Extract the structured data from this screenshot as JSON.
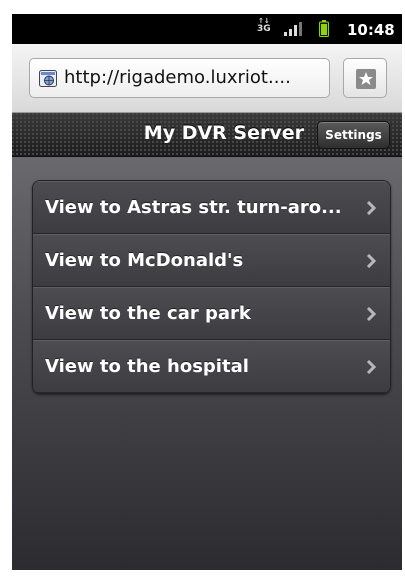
{
  "status_bar": {
    "network_label": "3G",
    "time": "10:48"
  },
  "browser": {
    "url": "http://rigademo.luxriot...."
  },
  "header": {
    "title": "My DVR Server",
    "settings_label": "Settings"
  },
  "cameras": [
    {
      "label": "View to Astras str. turn-aro..."
    },
    {
      "label": "View to McDonald's"
    },
    {
      "label": "View to the car park"
    },
    {
      "label": "View to the hospital"
    }
  ],
  "colors": {
    "battery": "#8ed400",
    "header_bg": "#2a2a2a",
    "list_bg": "#45454a"
  }
}
